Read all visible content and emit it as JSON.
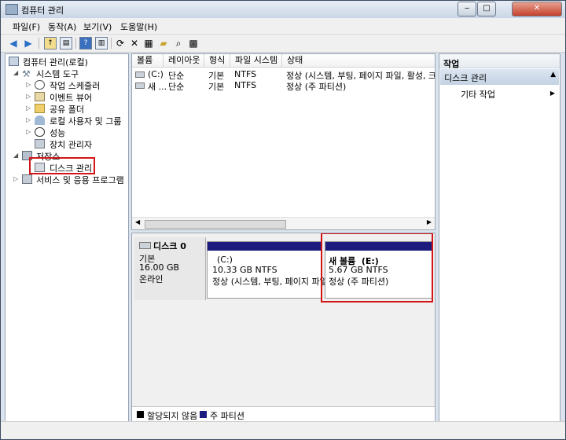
{
  "window": {
    "title": "컴퓨터 관리"
  },
  "title_controls": {
    "minimize": "‒",
    "maximize": "□",
    "close": "✕"
  },
  "menu": [
    "파일(F)",
    "동작(A)",
    "보기(V)",
    "도움말(H)"
  ],
  "toolbar_icons": [
    "back-icon",
    "forward-icon",
    "up-folder-icon",
    "console-tree-icon",
    "help-icon",
    "action-pane-icon",
    "refresh-icon",
    "delete-icon",
    "properties-icon",
    "open-folder-icon",
    "search-icon",
    "export-icon"
  ],
  "tree": {
    "root": "컴퓨터 관리(로컬)",
    "system_tools": "시스템 도구",
    "items": [
      "작업 스케줄러",
      "이벤트 뷰어",
      "공유 폴더",
      "로컬 사용자 및 그룹",
      "성능",
      "장치 관리자"
    ],
    "storage": "저장소",
    "disk_mgmt": "디스크 관리",
    "services": "서비스 및 응용 프로그램"
  },
  "volume_table": {
    "columns": [
      "볼륨",
      "레이아웃",
      "형식",
      "파일 시스템",
      "상태"
    ],
    "rows": [
      [
        "(C:)",
        "단순",
        "기본",
        "NTFS",
        "정상 (시스템, 부팅, 페이지 파일, 활성, 크래"
      ],
      [
        "새 ...",
        "단순",
        "기본",
        "NTFS",
        "정상 (주 파티션)"
      ]
    ]
  },
  "disk": {
    "name": "디스크 0",
    "type": "기본",
    "size": "16.00 GB",
    "status": "온라인",
    "volumes": [
      {
        "name": "(C:)",
        "size": "10.33 GB NTFS",
        "status": "정상 (시스템, 부팅, 페이지 파일"
      },
      {
        "name": "새 볼륨  (E:)",
        "size": "5.67 GB NTFS",
        "status": "정상 (주 파티션)"
      }
    ]
  },
  "legend": [
    {
      "label": "할당되지 않음",
      "color": "#000000"
    },
    {
      "label": "주 파티션",
      "color": "#1c1c7e"
    }
  ],
  "actions": {
    "header": "작업",
    "section": "디스크 관리",
    "more": "기타 작업"
  },
  "colors": {
    "highlight": "#d3151a",
    "partition": "#1c1c7e"
  }
}
